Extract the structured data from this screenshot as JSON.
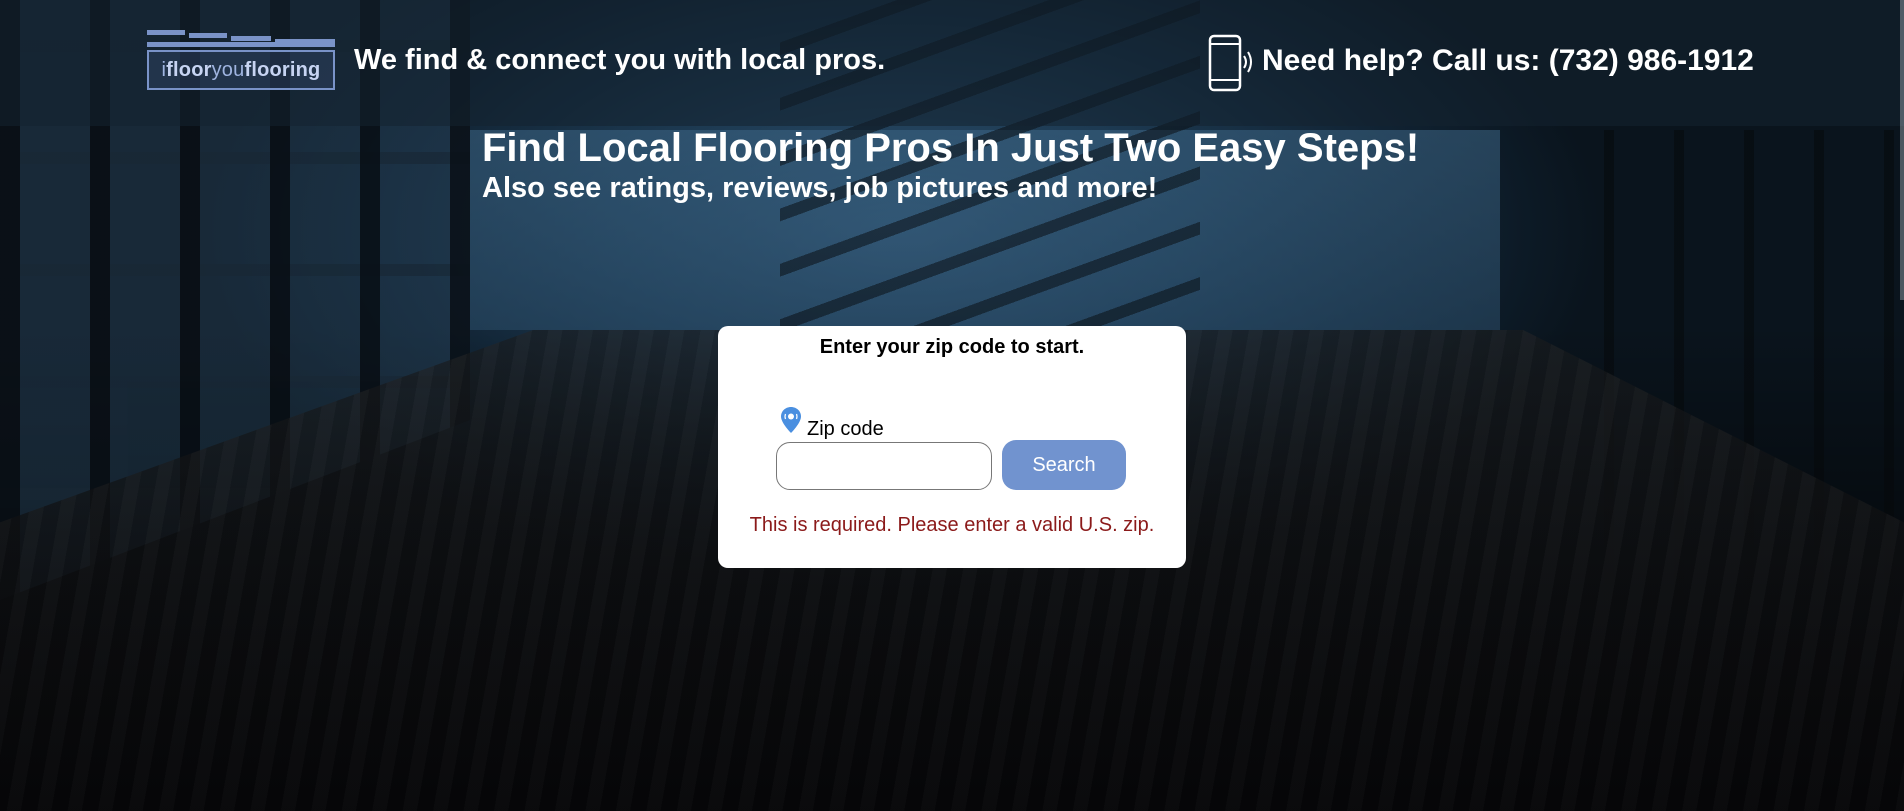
{
  "header": {
    "logo_text_prefix": "i",
    "logo_text_floor": "floor",
    "logo_text_you": "you",
    "logo_text_flooring": "flooring",
    "tagline": "We find & connect you with local pros.",
    "help_text": "Need help? Call us: (732) 986-1912",
    "phone_icon": "mobile-phone-ringing-icon"
  },
  "hero": {
    "headline": "Find Local Flooring Pros In Just Two Easy Steps!",
    "subheadline": "Also see ratings, reviews, job pictures and more!"
  },
  "zip_form": {
    "title": "Enter your zip code to start.",
    "pin_icon": "map-pin-icon",
    "label": "Zip code",
    "value": "",
    "button_label": "Search",
    "error": "This is required. Please enter a valid U.S. zip."
  },
  "colors": {
    "button": "#7193cf",
    "error": "#8b1a1a",
    "logo_border": "#7a93c8",
    "pin": "#4a8fe0"
  }
}
